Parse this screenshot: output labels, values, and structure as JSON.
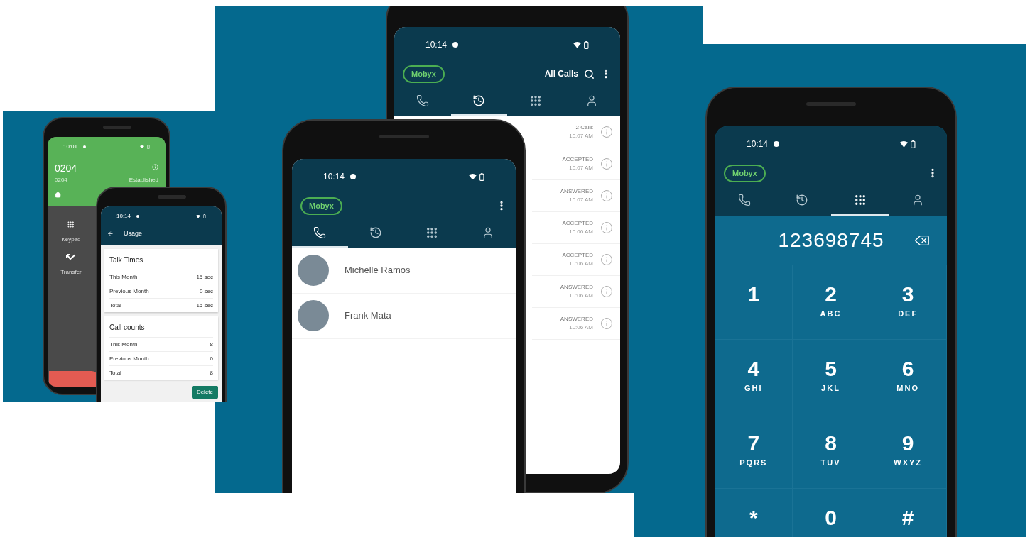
{
  "call_phone": {
    "status_time": "10:01",
    "number": "0204",
    "subtitle": "0204",
    "state": "Established",
    "actions": [
      {
        "kind": "keypad",
        "label": "Keypad"
      },
      {
        "kind": "transfer",
        "label": "Transfer"
      }
    ]
  },
  "usage_phone": {
    "status_time": "10:14",
    "title": "Usage",
    "cards": [
      {
        "title": "Talk Times",
        "rows": [
          {
            "label": "This Month",
            "value": "15 sec"
          },
          {
            "label": "Previous Month",
            "value": "0 sec"
          },
          {
            "label": "Total",
            "value": "15 sec"
          }
        ]
      },
      {
        "title": "Call counts",
        "rows": [
          {
            "label": "This Month",
            "value": "8"
          },
          {
            "label": "Previous Month",
            "value": "0"
          },
          {
            "label": "Total",
            "value": "8"
          }
        ]
      }
    ],
    "delete_button": "Delete"
  },
  "call_log_phone": {
    "status_time": "10:14",
    "brand": "Mobyx",
    "filter": "All Calls",
    "tabs": [
      {
        "kind": "calls",
        "selected": false
      },
      {
        "kind": "history",
        "selected": true
      },
      {
        "kind": "keypad",
        "selected": false
      },
      {
        "kind": "contacts",
        "selected": false
      }
    ],
    "calls": [
      {
        "status": "2 Calls",
        "time": "10:07 AM"
      },
      {
        "status": "ACCEPTED",
        "time": "10:07 AM"
      },
      {
        "status": "ANSWERED",
        "time": "10:07 AM"
      },
      {
        "status": "ACCEPTED",
        "time": "10:06 AM"
      },
      {
        "status": "ACCEPTED",
        "time": "10:06 AM"
      },
      {
        "status": "ANSWERED",
        "time": "10:06 AM"
      },
      {
        "status": "ANSWERED",
        "time": "10:06 AM"
      }
    ]
  },
  "contacts_phone": {
    "status_time": "10:14",
    "brand": "Mobyx",
    "tabs": [
      {
        "kind": "calls",
        "selected": true
      },
      {
        "kind": "history",
        "selected": false
      },
      {
        "kind": "keypad",
        "selected": false
      },
      {
        "kind": "contacts",
        "selected": false
      }
    ],
    "contacts": [
      {
        "name": "Michelle Ramos"
      },
      {
        "name": "Frank Mata"
      }
    ]
  },
  "dialer_phone": {
    "status_time": "10:14",
    "brand": "Mobyx",
    "tabs": [
      {
        "kind": "calls",
        "selected": false
      },
      {
        "kind": "history",
        "selected": false
      },
      {
        "kind": "keypad",
        "selected": true
      },
      {
        "kind": "contacts",
        "selected": false
      }
    ],
    "number": "123698745",
    "keys": [
      {
        "digit": "1"
      },
      {
        "digit": "2",
        "letters": "ABC"
      },
      {
        "digit": "3",
        "letters": "DEF"
      },
      {
        "digit": "4",
        "letters": "GHI"
      },
      {
        "digit": "5",
        "letters": "JKL"
      },
      {
        "digit": "6",
        "letters": "MNO"
      },
      {
        "digit": "7",
        "letters": "PQRS"
      },
      {
        "digit": "8",
        "letters": "TUV"
      },
      {
        "digit": "9",
        "letters": "WXYZ"
      },
      {
        "digit": "*"
      },
      {
        "digit": "0"
      },
      {
        "digit": "#"
      }
    ]
  }
}
